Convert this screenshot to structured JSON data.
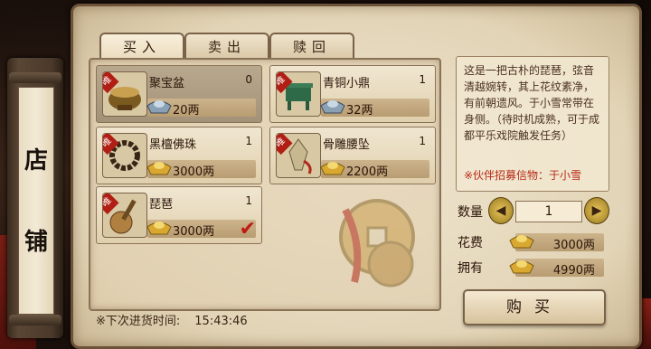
{
  "side_title": [
    "店",
    "铺"
  ],
  "tabs": [
    {
      "label": "买入",
      "active": true
    },
    {
      "label": "卖出",
      "active": false
    },
    {
      "label": "赎回",
      "active": false
    }
  ],
  "items": [
    {
      "name": "聚宝盆",
      "count": "0",
      "price": "20两",
      "badge": "唯",
      "icon": "treasure-bowl-icon",
      "currency": "silver",
      "selected": true,
      "checked": false
    },
    {
      "name": "青铜小鼎",
      "count": "1",
      "price": "32两",
      "badge": "唯",
      "icon": "bronze-cauldron-icon",
      "currency": "silver",
      "selected": false,
      "checked": false
    },
    {
      "name": "黑檀佛珠",
      "count": "1",
      "price": "3000两",
      "badge": "唯",
      "icon": "prayer-beads-icon",
      "currency": "gold",
      "selected": false,
      "checked": false
    },
    {
      "name": "骨雕腰坠",
      "count": "1",
      "price": "2200两",
      "badge": "唯",
      "icon": "bone-pendant-icon",
      "currency": "gold",
      "selected": false,
      "checked": false
    },
    {
      "name": "琵琶",
      "count": "1",
      "price": "3000两",
      "badge": "唯",
      "icon": "pipa-lute-icon",
      "currency": "gold",
      "selected": false,
      "checked": true
    }
  ],
  "restock": {
    "label": "※下次进货时间:",
    "time": "15:43:46"
  },
  "description": {
    "text": "这是一把古朴的琵琶，弦音清越婉转，其上花纹素净，有前朝遗风。于小雪常带在身侧。（待时机成熟，可于成都平乐戏院触发任务）",
    "note": "※伙伴招募信物：于小雪"
  },
  "quantity": {
    "label": "数量",
    "value": "1",
    "dec": "◀",
    "inc": "▶"
  },
  "cost": {
    "label": "花费",
    "value": "3000两"
  },
  "owned": {
    "label": "拥有",
    "value": "4990两"
  },
  "buy_button": "购买",
  "colors": {
    "accent_red": "#b01e14",
    "gold": "#e6c45a",
    "parchment": "#efe5cf"
  }
}
